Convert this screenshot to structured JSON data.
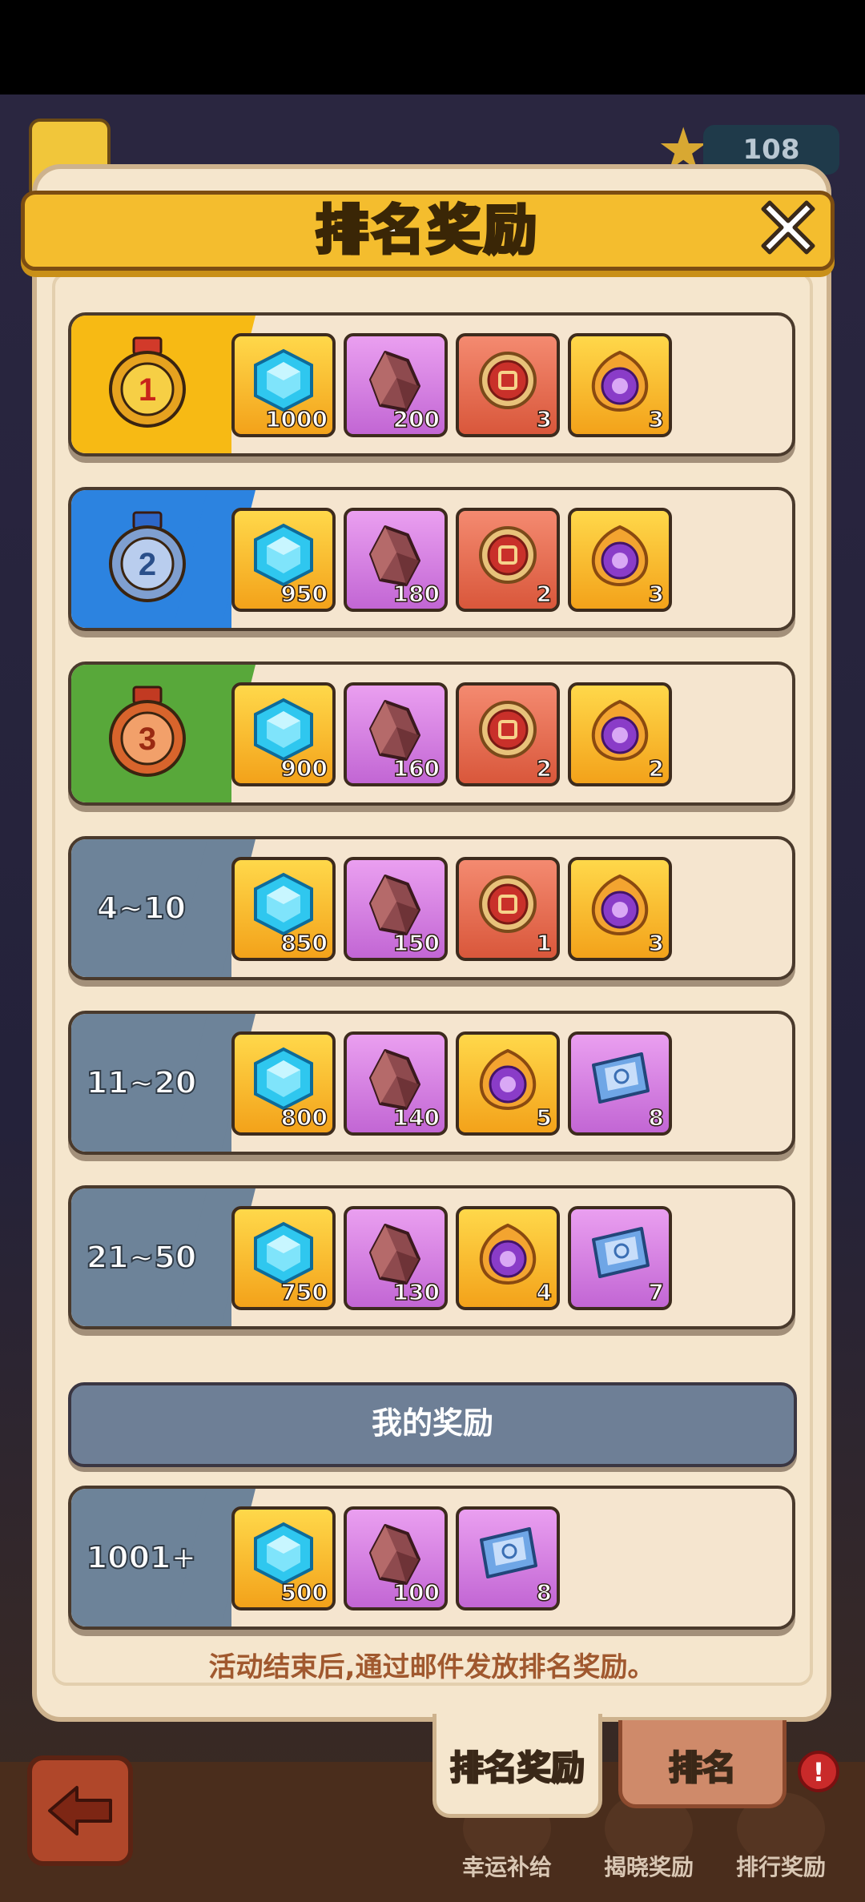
{
  "header": {
    "title": "排名奖励"
  },
  "background": {
    "star_count": "108"
  },
  "rows": [
    {
      "rank_label": "",
      "badge": "gold",
      "medal": "1",
      "items": [
        {
          "type": "diamond",
          "count": "1000",
          "bg": "yellow"
        },
        {
          "type": "ore",
          "count": "200",
          "bg": "pink"
        },
        {
          "type": "emblem",
          "count": "3",
          "bg": "red"
        },
        {
          "type": "orb",
          "count": "3",
          "bg": "yellow"
        }
      ]
    },
    {
      "rank_label": "",
      "badge": "blue",
      "medal": "2",
      "items": [
        {
          "type": "diamond",
          "count": "950",
          "bg": "yellow"
        },
        {
          "type": "ore",
          "count": "180",
          "bg": "pink"
        },
        {
          "type": "emblem",
          "count": "2",
          "bg": "red"
        },
        {
          "type": "orb",
          "count": "3",
          "bg": "yellow"
        }
      ]
    },
    {
      "rank_label": "",
      "badge": "green",
      "medal": "3",
      "items": [
        {
          "type": "diamond",
          "count": "900",
          "bg": "yellow"
        },
        {
          "type": "ore",
          "count": "160",
          "bg": "pink"
        },
        {
          "type": "emblem",
          "count": "2",
          "bg": "red"
        },
        {
          "type": "orb",
          "count": "2",
          "bg": "yellow"
        }
      ]
    },
    {
      "rank_label": "4~10",
      "badge": "gray",
      "medal": "",
      "items": [
        {
          "type": "diamond",
          "count": "850",
          "bg": "yellow"
        },
        {
          "type": "ore",
          "count": "150",
          "bg": "pink"
        },
        {
          "type": "emblem",
          "count": "1",
          "bg": "red"
        },
        {
          "type": "orb",
          "count": "3",
          "bg": "yellow"
        }
      ]
    },
    {
      "rank_label": "11~20",
      "badge": "gray",
      "medal": "",
      "items": [
        {
          "type": "diamond",
          "count": "800",
          "bg": "yellow"
        },
        {
          "type": "ore",
          "count": "140",
          "bg": "pink"
        },
        {
          "type": "orb",
          "count": "5",
          "bg": "yellow"
        },
        {
          "type": "scroll",
          "count": "8",
          "bg": "pink"
        }
      ]
    },
    {
      "rank_label": "21~50",
      "badge": "gray",
      "medal": "",
      "items": [
        {
          "type": "diamond",
          "count": "750",
          "bg": "yellow"
        },
        {
          "type": "ore",
          "count": "130",
          "bg": "pink"
        },
        {
          "type": "orb",
          "count": "4",
          "bg": "yellow"
        },
        {
          "type": "scroll",
          "count": "7",
          "bg": "pink"
        }
      ]
    }
  ],
  "my_reward": {
    "title": "我的奖励",
    "rank_label": "1001+",
    "badge": "gray",
    "items": [
      {
        "type": "diamond",
        "count": "500",
        "bg": "yellow"
      },
      {
        "type": "ore",
        "count": "100",
        "bg": "pink"
      },
      {
        "type": "scroll",
        "count": "8",
        "bg": "pink"
      }
    ]
  },
  "footnote": "活动结束后,通过邮件发放排名奖励。",
  "tabs": [
    {
      "label": "排名奖励",
      "active": true
    },
    {
      "label": "排名",
      "active": false
    }
  ],
  "bottom_nav": [
    {
      "label": "幸运补给",
      "icon": "supply-icon"
    },
    {
      "label": "揭晓奖励",
      "icon": "reveal-reward-icon"
    },
    {
      "label": "排行奖励",
      "icon": "leaderboard-reward-icon"
    }
  ],
  "alert_badge": "!"
}
